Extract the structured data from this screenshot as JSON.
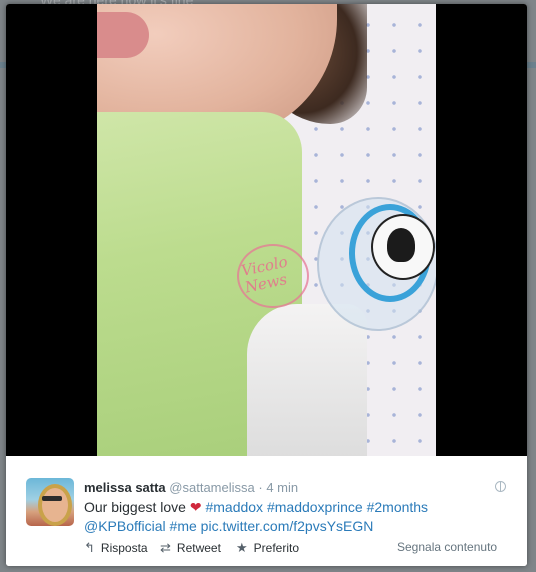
{
  "backdrop": {
    "text": "We are here now it's fine"
  },
  "tweet": {
    "name": "melissa satta",
    "handle": "@sattamelissa",
    "separator": "·",
    "time": "4 min",
    "text_plain": "Our biggest love",
    "heart": "❤",
    "hashtags": [
      "#maddox",
      "#maddoxprince",
      "#2months"
    ],
    "mention": "@KPBofficial",
    "hashtag_me": "#me",
    "pic_link": "pic.twitter.com/f2pvsYsEGN"
  },
  "actions": {
    "reply": "Risposta",
    "retweet": "Retweet",
    "favorite": "Preferito",
    "report": "Segnala contenuto"
  },
  "watermark": {
    "line1": "Vicolo",
    "line2": "News"
  },
  "colors": {
    "link": "#2b7bb9",
    "heart": "#d0283c",
    "name": "#292f33",
    "muted": "#8899a6"
  },
  "icons": {
    "reply": "reply-arrow-icon",
    "retweet": "retweet-icon",
    "favorite": "star-icon",
    "globe": "globe-icon"
  }
}
